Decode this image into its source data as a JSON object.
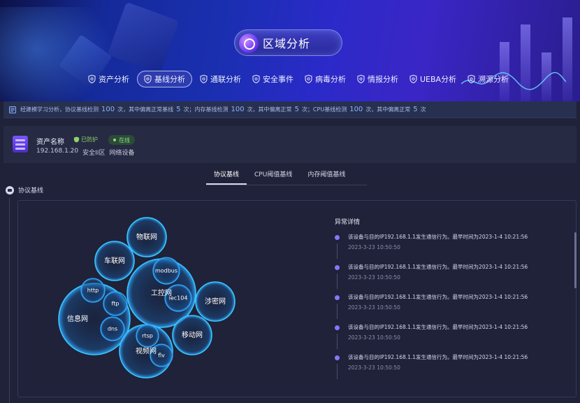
{
  "header": {
    "title": "区域分析",
    "nav": [
      {
        "label": "资产分析",
        "active": false
      },
      {
        "label": "基线分析",
        "active": true
      },
      {
        "label": "通联分析",
        "active": false
      },
      {
        "label": "安全事件",
        "active": false
      },
      {
        "label": "病毒分析",
        "active": false
      },
      {
        "label": "情报分析",
        "active": false
      },
      {
        "label": "UEBA分析",
        "active": false
      },
      {
        "label": "溯源分析",
        "active": false
      }
    ]
  },
  "strip": {
    "p1": "经建模学习分析，协议基线检测",
    "n1": "100",
    "p2": "次，其中偏离正常基线",
    "n2": "5",
    "p3": "次；内存基线检测",
    "n3": "100",
    "p4": "次，其中偏离正常",
    "n4": "5",
    "p5": "次；CPU基线检测",
    "n5": "100",
    "p6": "次，其中偏离正常",
    "n6": "5",
    "p7": "次"
  },
  "asset": {
    "name": "资产名称",
    "protect_tag": "已防护",
    "online_tag": "在线",
    "ip": "192.168.1.20",
    "zone": "安全II区",
    "type": "网络设备"
  },
  "tabs": [
    "协议基线",
    "CPU阈值基线",
    "内存阈值基线"
  ],
  "section_title": "协议基线",
  "bubbles": {
    "groups": [
      "物联网",
      "车联网",
      "工控网",
      "信息网",
      "涉密网",
      "移动网",
      "视频网"
    ],
    "protocols": [
      "modbus",
      "iec104",
      "http",
      "ftp",
      "dns",
      "rtsp",
      "flv"
    ]
  },
  "details": {
    "title": "异常详情",
    "items": [
      {
        "text": "该设备与目的IP192.168.1.1发生通信行为。最早时间为2023-1-4 10:21:56",
        "time": "2023-3-23 10:50:50"
      },
      {
        "text": "该设备与目的IP192.168.1.1发生通信行为。最早时间为2023-1-4 10:21:56",
        "time": "2023-3-23 10:50:50"
      },
      {
        "text": "该设备与目的IP192.168.1.1发生通信行为。最早时间为2023-1-4 10:21:56",
        "time": "2023-3-23 10:50:50"
      },
      {
        "text": "该设备与目的IP192.168.1.1发生通信行为。最早时间为2023-1-4 10:21:56",
        "time": "2023-3-23 10:50:50"
      },
      {
        "text": "该设备与目的IP192.168.1.1发生通信行为。最早时间为2023-1-4 10:21:56",
        "time": "2023-3-23 10:50:50"
      }
    ]
  }
}
